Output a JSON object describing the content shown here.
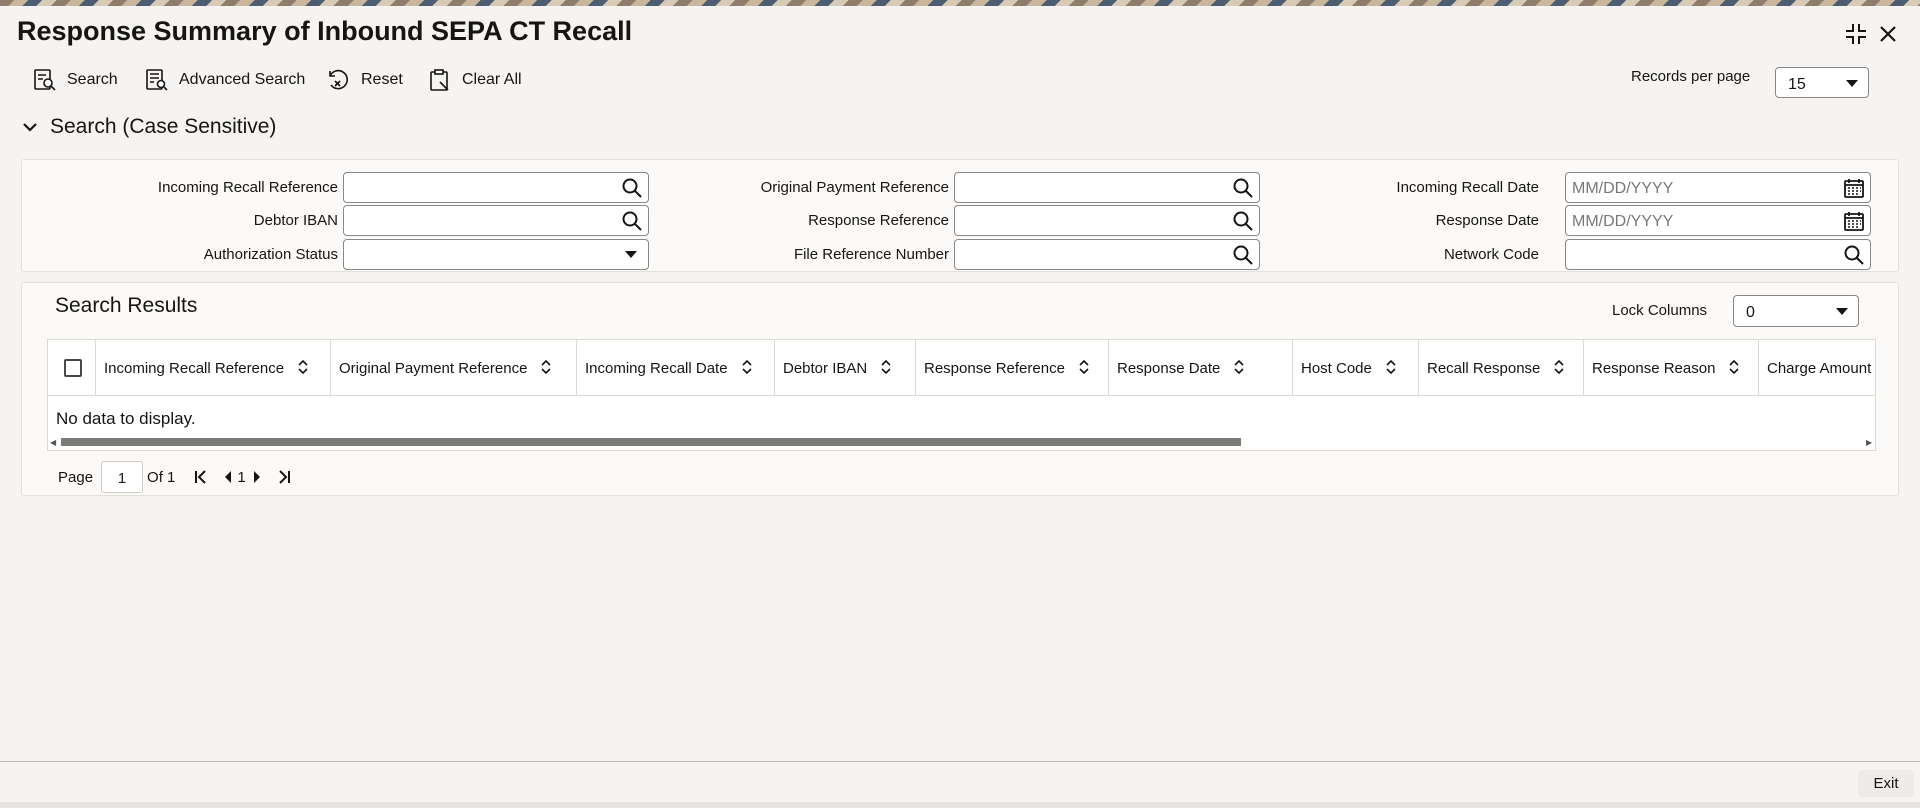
{
  "window": {
    "title": "Response Summary of Inbound SEPA CT Recall"
  },
  "toolbar": {
    "search_label": "Search",
    "advanced_search_label": "Advanced Search",
    "reset_label": "Reset",
    "clear_all_label": "Clear All",
    "records_per_page_label": "Records per page",
    "records_per_page_value": "15"
  },
  "search_section": {
    "title": "Search (Case Sensitive)",
    "fields": {
      "incoming_recall_reference": {
        "label": "Incoming Recall Reference",
        "value": ""
      },
      "debtor_iban": {
        "label": "Debtor IBAN",
        "value": ""
      },
      "authorization_status": {
        "label": "Authorization Status",
        "value": ""
      },
      "original_payment_reference": {
        "label": "Original Payment Reference",
        "value": ""
      },
      "response_reference": {
        "label": "Response Reference",
        "value": ""
      },
      "file_reference_number": {
        "label": "File Reference Number",
        "value": ""
      },
      "incoming_recall_date": {
        "label": "Incoming Recall Date",
        "placeholder": "MM/DD/YYYY"
      },
      "response_date": {
        "label": "Response Date",
        "placeholder": "MM/DD/YYYY"
      },
      "network_code": {
        "label": "Network Code",
        "value": ""
      }
    }
  },
  "results": {
    "title": "Search Results",
    "lock_columns_label": "Lock Columns",
    "lock_columns_value": "0",
    "columns": [
      "Incoming Recall Reference",
      "Original Payment Reference",
      "Incoming Recall Date",
      "Debtor IBAN",
      "Response Reference",
      "Response Date",
      "Host Code",
      "Recall Response",
      "Response Reason",
      "Charge Amount"
    ],
    "empty_message": "No data to display."
  },
  "pagination": {
    "page_label": "Page",
    "current_page": "1",
    "of_label": "Of 1",
    "page_number": "1"
  },
  "footer": {
    "exit_label": "Exit"
  }
}
